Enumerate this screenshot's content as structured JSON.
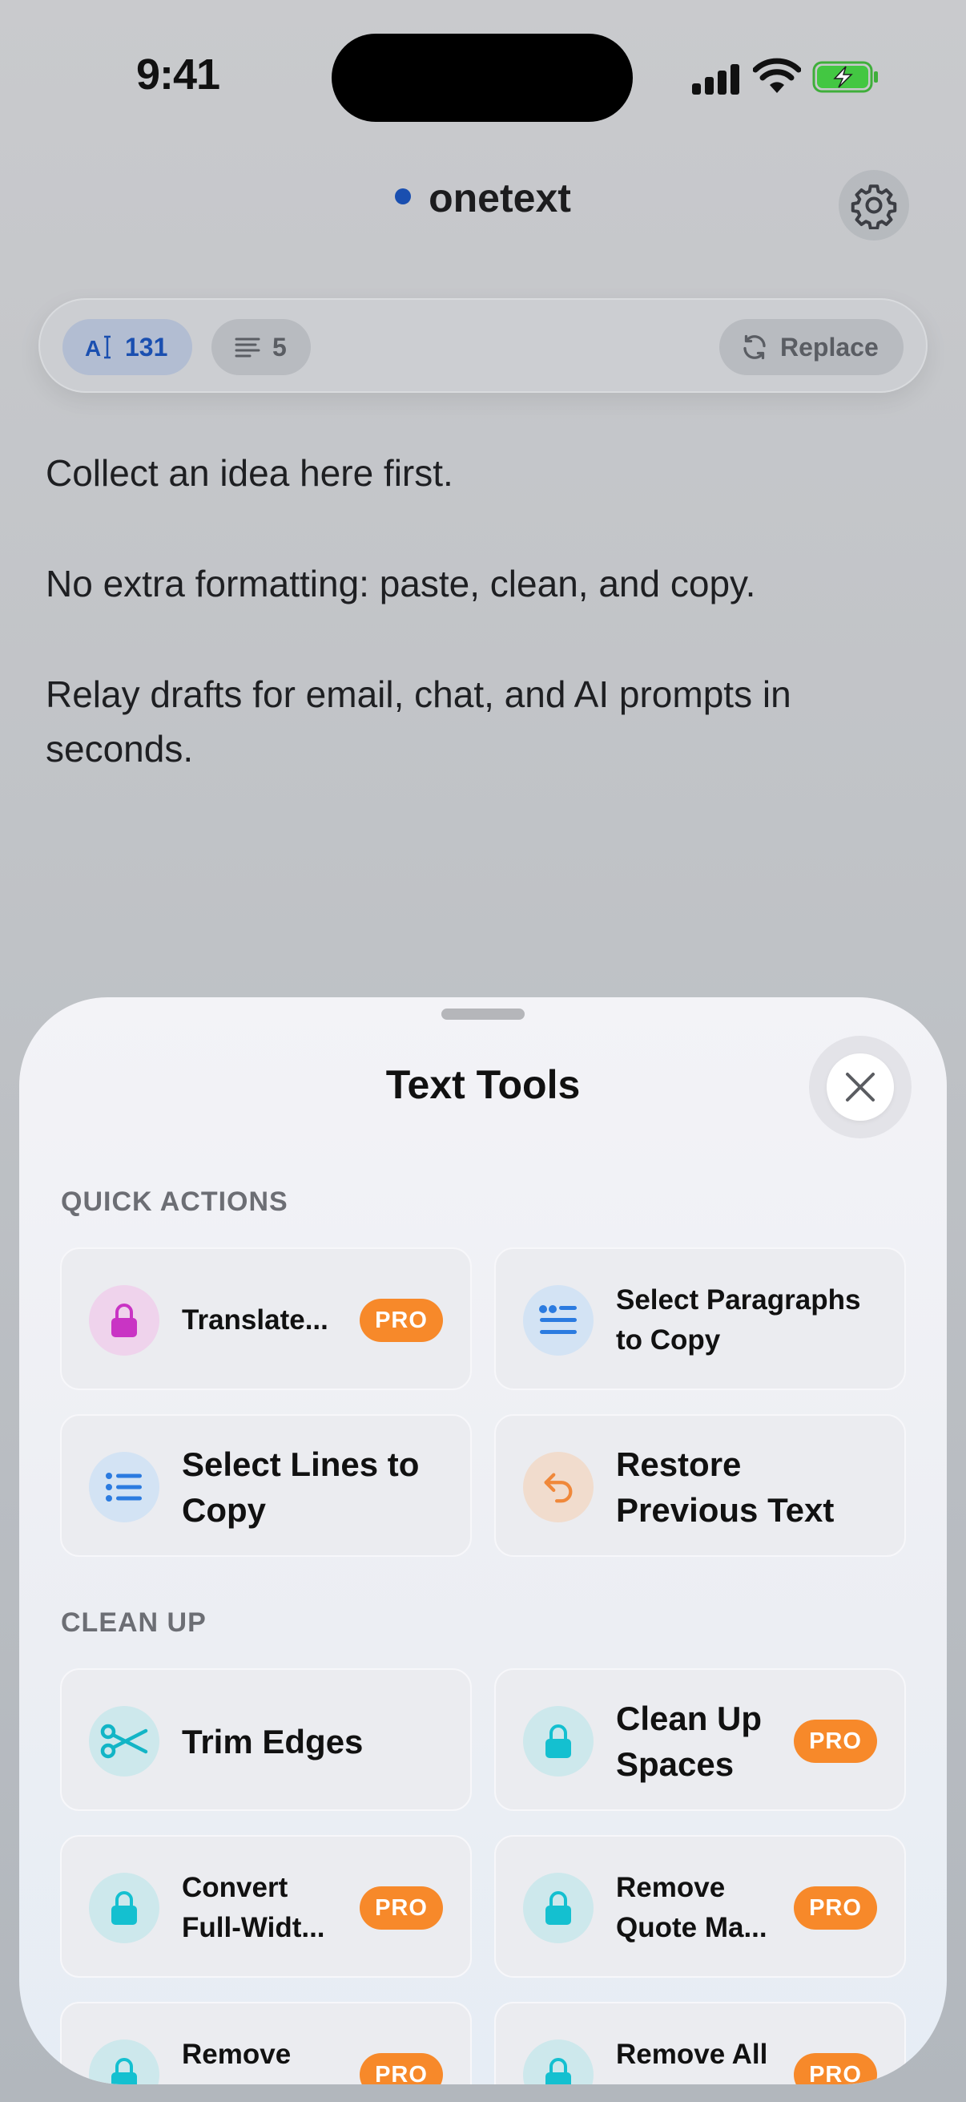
{
  "status_bar": {
    "time": "9:41"
  },
  "header": {
    "title": "onetext",
    "settings_icon": "gear-icon"
  },
  "toolbar": {
    "char_count": "131",
    "line_count": "5",
    "replace_label": "Replace",
    "accent": "#1a4fb0"
  },
  "editor": {
    "paragraphs": [
      "Collect an idea here first.",
      "No extra formatting: paste, clean, and copy.",
      "Relay drafts for email, chat, and AI prompts in seconds."
    ]
  },
  "sheet": {
    "title": "Text Tools",
    "quick_actions": {
      "label": "QUICK ACTIONS",
      "items": [
        {
          "label": "Translate...",
          "icon": "lock-icon",
          "pro": "PRO"
        },
        {
          "label": "Select Paragraphs to Copy",
          "icon": "quote-paragraph-icon"
        },
        {
          "label": "Select Lines to Copy",
          "icon": "list-icon"
        },
        {
          "label": "Restore Previous Text",
          "icon": "undo-arrow-icon"
        }
      ]
    },
    "clean_up": {
      "label": "CLEAN UP",
      "items": [
        {
          "label": "Trim Edges",
          "icon": "scissors-icon"
        },
        {
          "label": "Clean Up Spaces",
          "icon": "lock-icon",
          "pro": "PRO"
        },
        {
          "label": "Convert Full-Widt...",
          "icon": "lock-icon",
          "pro": "PRO"
        },
        {
          "label": "Remove Quote Ma...",
          "icon": "lock-icon",
          "pro": "PRO"
        },
        {
          "label": "Remove",
          "icon": "lock-icon",
          "pro": "PRO"
        },
        {
          "label": "Remove All",
          "icon": "lock-icon",
          "pro": "PRO"
        }
      ]
    },
    "pro_color": "#f7892a"
  }
}
